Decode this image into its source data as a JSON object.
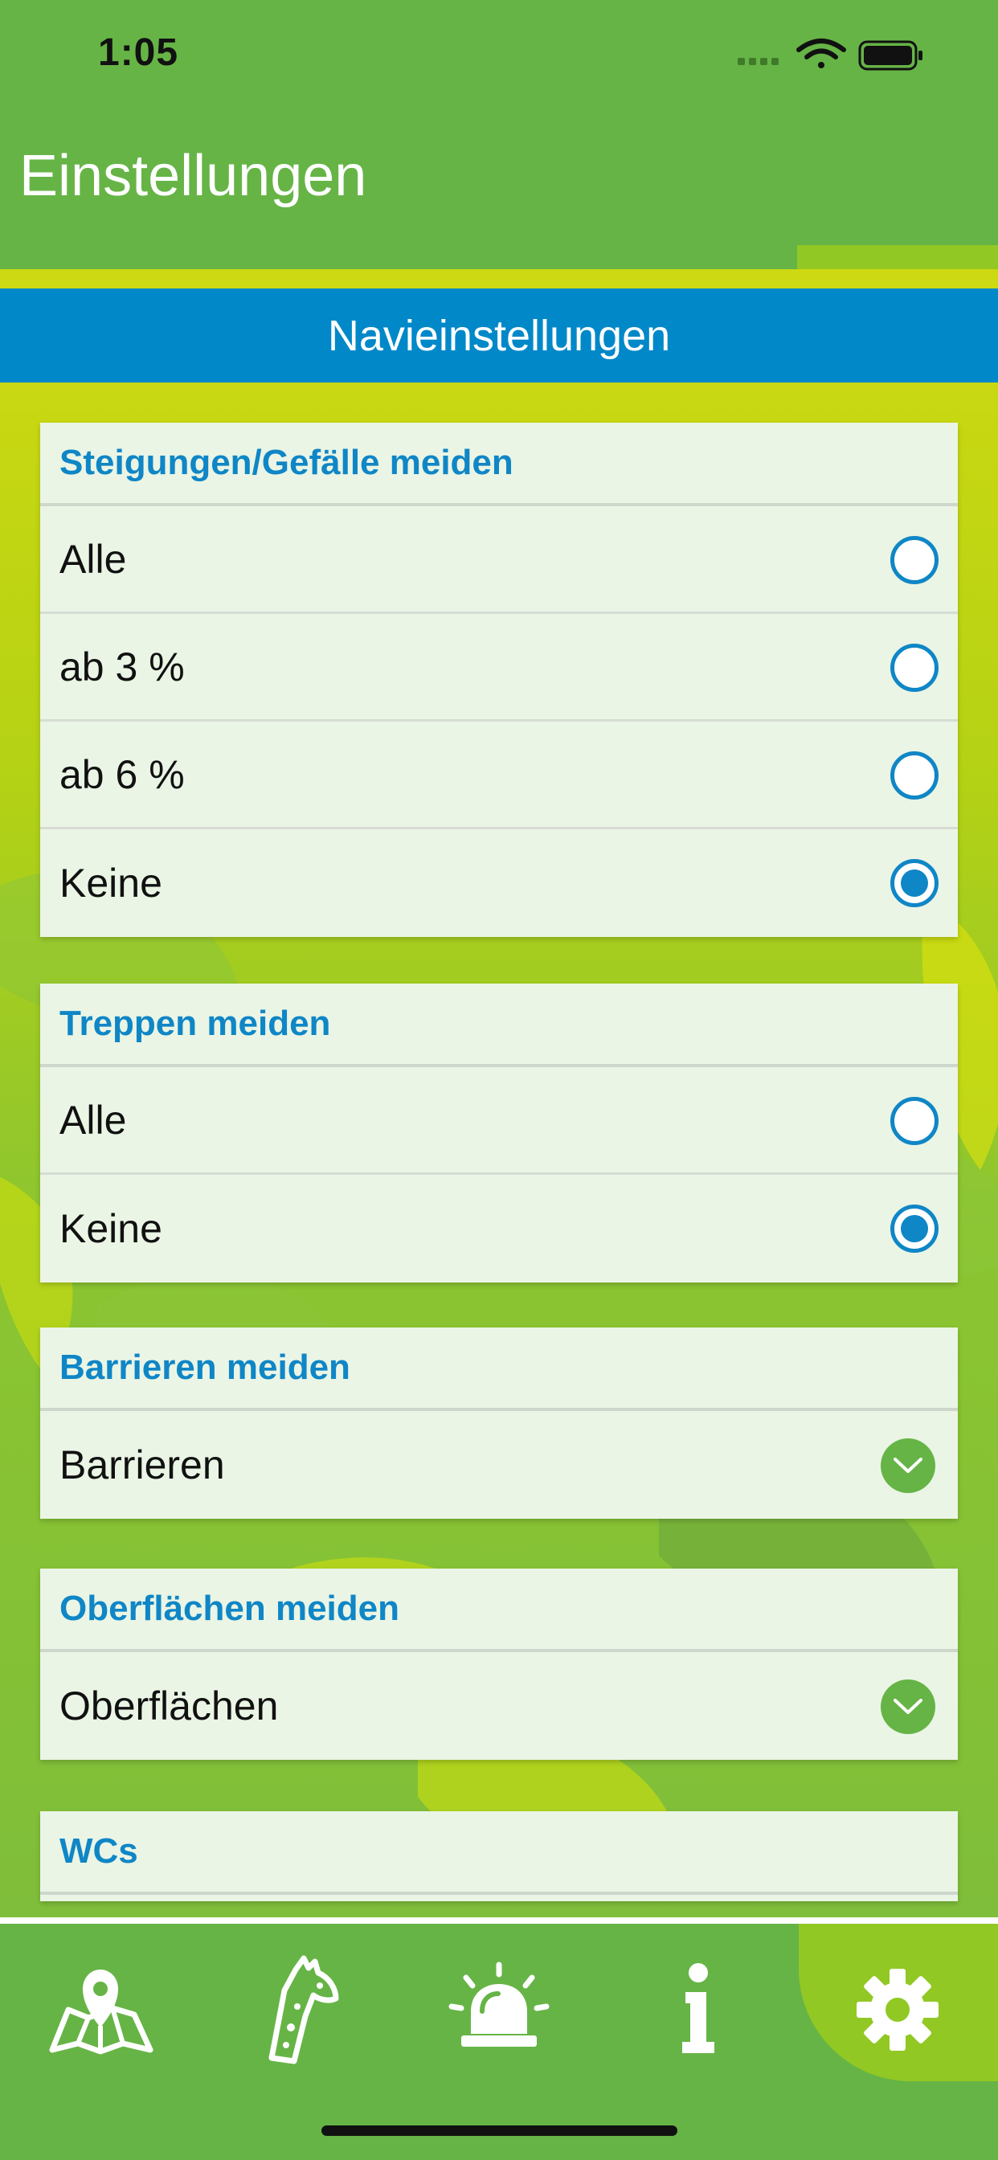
{
  "status": {
    "time": "1:05"
  },
  "header": {
    "title": "Einstellungen"
  },
  "section": {
    "title": "Navieinstellungen"
  },
  "cards": {
    "steigungen": {
      "title": "Steigungen/Gefälle meiden",
      "options": [
        {
          "label": "Alle",
          "checked": false
        },
        {
          "label": "ab 3 %",
          "checked": false
        },
        {
          "label": "ab 6 %",
          "checked": false
        },
        {
          "label": "Keine",
          "checked": true
        }
      ]
    },
    "treppen": {
      "title": "Treppen meiden",
      "options": [
        {
          "label": "Alle",
          "checked": false
        },
        {
          "label": "Keine",
          "checked": true
        }
      ]
    },
    "barrieren": {
      "title": "Barrieren meiden",
      "value": "Barrieren"
    },
    "oberflaechen": {
      "title": "Oberflächen meiden",
      "value": "Oberflächen"
    },
    "wcs": {
      "title": "WCs"
    }
  },
  "tabs": [
    {
      "icon": "map-icon",
      "active": false
    },
    {
      "icon": "giraffe-icon",
      "active": false
    },
    {
      "icon": "alarm-light-icon",
      "active": false
    },
    {
      "icon": "info-icon",
      "active": false
    },
    {
      "icon": "gear-icon",
      "active": true
    }
  ],
  "colors": {
    "green": "#66b446",
    "lime": "#92c824",
    "blue": "#0088c9",
    "card": "#eaf5e5"
  }
}
